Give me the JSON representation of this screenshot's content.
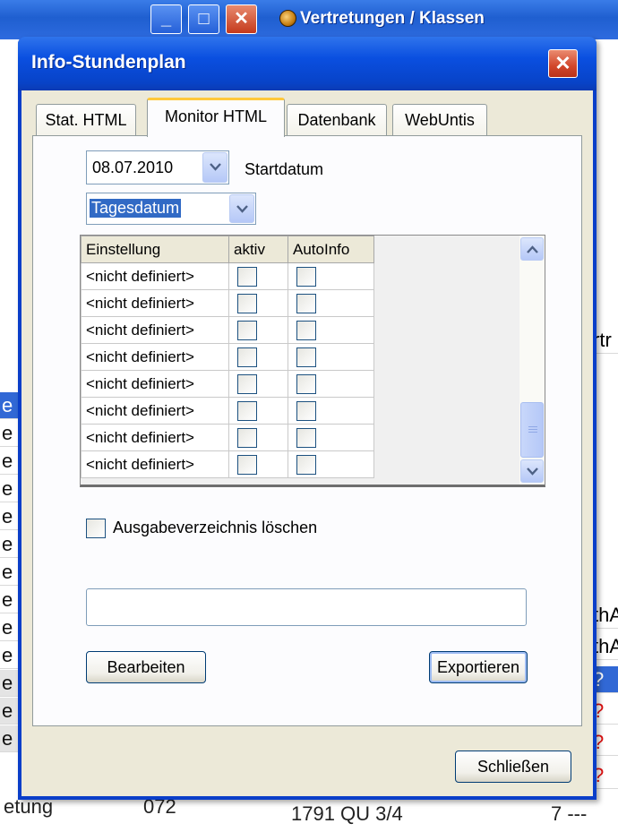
{
  "background_app": {
    "title": "Vertretungen / Klassen",
    "left_rows": [
      "e",
      "e",
      "e",
      "e",
      "e",
      "e",
      "e",
      "e",
      "e",
      "e",
      "e",
      "e",
      "e"
    ],
    "right_cells": [
      "rtr",
      "thA",
      "thA",
      "?",
      "?",
      "?",
      "?"
    ],
    "bottom_left_text": "etung",
    "bottom_mid_text": "072",
    "bottom_right_text": "1791  QU 3/4",
    "bottom_far_text": "7 ---"
  },
  "dialog": {
    "title": "Info-Stundenplan",
    "close_glyph": "✕",
    "tabs": [
      {
        "label": "Stat. HTML",
        "active": false
      },
      {
        "label": "Monitor HTML",
        "active": true
      },
      {
        "label": "Datenbank",
        "active": false
      },
      {
        "label": "WebUntis",
        "active": false
      }
    ],
    "date_combo": {
      "value": "08.07.2010",
      "label": "Startdatum"
    },
    "mode_combo": {
      "value": "Tagesdatum"
    },
    "grid": {
      "columns": [
        "Einstellung",
        "aktiv",
        "AutoInfo"
      ],
      "rows": [
        {
          "name": "<nicht definiert>",
          "aktiv": false,
          "autoinfo": false
        },
        {
          "name": "<nicht definiert>",
          "aktiv": false,
          "autoinfo": false
        },
        {
          "name": "<nicht definiert>",
          "aktiv": false,
          "autoinfo": false
        },
        {
          "name": "<nicht definiert>",
          "aktiv": false,
          "autoinfo": false
        },
        {
          "name": "<nicht definiert>",
          "aktiv": false,
          "autoinfo": false
        },
        {
          "name": "<nicht definiert>",
          "aktiv": false,
          "autoinfo": false
        },
        {
          "name": "<nicht definiert>",
          "aktiv": false,
          "autoinfo": false
        },
        {
          "name": "<nicht definiert>",
          "aktiv": false,
          "autoinfo": false
        }
      ]
    },
    "clear_output_checkbox": {
      "label": "Ausgabeverzeichnis löschen",
      "checked": false
    },
    "path_field": {
      "value": ""
    },
    "edit_button": "Bearbeiten",
    "export_button": "Exportieren",
    "close_button": "Schließen"
  },
  "colors": {
    "xp_blue": "#0A3EC9",
    "dialog_face": "#ECE9D8",
    "active_tab_accent": "#FFC83C",
    "selection": "#316AC5"
  }
}
